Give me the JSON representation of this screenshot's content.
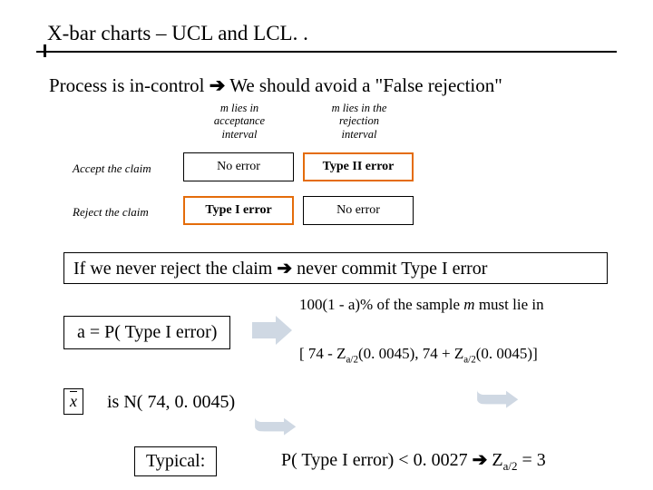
{
  "title": "X-bar charts – UCL and LCL. .",
  "subhead_a": "Process is in-control ",
  "subhead_b": " We should avoid a \"False rejection\"",
  "arrow": "➔",
  "table": {
    "col1_l1": "m lies in",
    "col1_l2": "acceptance",
    "col1_l3": "interval",
    "col2_l1": "m lies in the",
    "col2_l2": "rejection",
    "col2_l3": "interval",
    "row1": "Accept the claim",
    "row2": "Reject the claim",
    "c11": "No error",
    "c12": "Type II error",
    "c21": "Type I error",
    "c22": "No error"
  },
  "stmt1_a": "If we never reject the claim ",
  "stmt1_b": " never commit Type I error",
  "alpha_eq": "a = P( Type I error)",
  "rhs1_a": "100(1 - a)% of the sample ",
  "rhs1_m": "m",
  "rhs1_b": " must lie in",
  "rhs2": "[ 74 - Za/2(0. 0045), 74 + Za/2(0. 0045)]",
  "rhs2_pre": "[ 74 - Z",
  "rhs2_sub": "a/2",
  "rhs2_mid": "(0. 0045), 74 + Z",
  "rhs2_post": "(0. 0045)]",
  "xbar": "x",
  "isN": "is   N( 74, 0. 0045)",
  "typical": "Typical:",
  "pline_a": "P( Type I error) < 0. 0027   ",
  "pline_b": "   Z",
  "pline_c": " = 3",
  "chart_data": {
    "type": "table",
    "title": "Hypothesis-testing error table",
    "columns": [
      "",
      "μ lies in acceptance interval",
      "μ lies in the rejection interval"
    ],
    "rows": [
      [
        "Accept the claim",
        "No error",
        "Type II error"
      ],
      [
        "Reject the claim",
        "Type I error",
        "No error"
      ]
    ]
  }
}
